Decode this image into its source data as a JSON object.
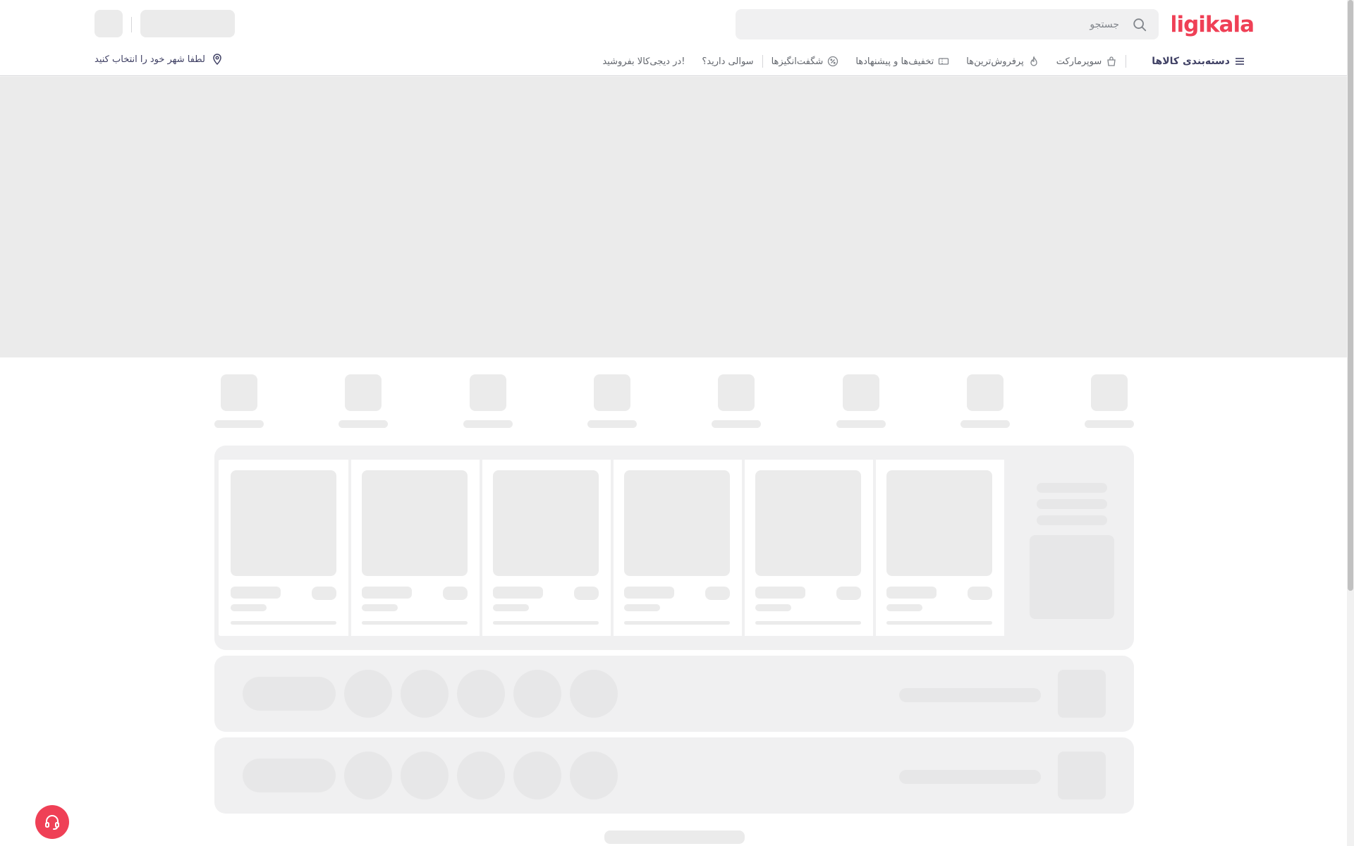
{
  "header": {
    "logo_text": "digikala",
    "brand_color": "#ef4056",
    "search": {
      "placeholder": "جستجو"
    },
    "location_text": "لطفا شهر خود را انتخاب کنید"
  },
  "nav": {
    "categories_label": "دسته‌بندی کالاها",
    "items": [
      {
        "label": "سوپرمارکت",
        "icon": "supermarket-icon"
      },
      {
        "label": "پرفروش‌ترین‌ها",
        "icon": "flame-icon"
      },
      {
        "label": "تخفیف‌ها و پیشنهادها",
        "icon": "coupon-icon"
      },
      {
        "label": "شگفت‌انگیزها",
        "icon": "percent-icon"
      },
      {
        "label": "سوالی دارید؟"
      },
      {
        "label": "در دیجی‌کالا بفروشید!"
      }
    ]
  },
  "colors": {
    "skeleton": "#ebebeb",
    "section_bg": "#f0f0f1",
    "support_button": "#ef4056"
  }
}
